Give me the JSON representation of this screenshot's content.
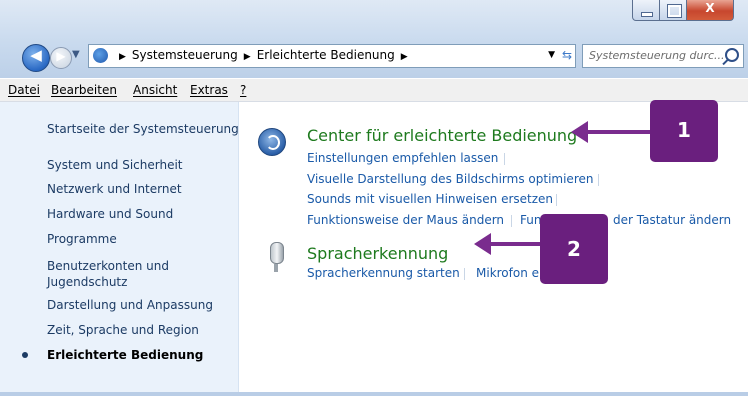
{
  "window": {
    "close_glyph": "X"
  },
  "navigation": {
    "back_glyph": "◀",
    "forward_glyph": "▶"
  },
  "address_bar": {
    "crumbs": [
      "Systemsteuerung",
      "Erleichterte Bedienung"
    ]
  },
  "search": {
    "placeholder": "Systemsteuerung durc..."
  },
  "menu": {
    "items": [
      "Datei",
      "Bearbeiten",
      "Ansicht",
      "Extras",
      "?"
    ]
  },
  "sidebar": {
    "items": [
      "Startseite der Systemsteuerung",
      "System und Sicherheit",
      "Netzwerk und Internet",
      "Hardware und Sound",
      "Programme",
      "Benutzerkonten und",
      "Jugendschutz",
      "Darstellung und Anpassung",
      "Zeit, Sprache und Region",
      "Erleichterte Bedienung"
    ]
  },
  "categories": [
    {
      "title": "Center für erleichterte Bedienung",
      "tasks": [
        "Einstellungen empfehlen lassen",
        "Visuelle Darstellung des Bildschirms optimieren",
        "Sounds mit visuellen Hinweisen ersetzen",
        "Funktionsweise der Maus ändern",
        "Fun",
        "der Tastatur ändern"
      ]
    },
    {
      "title": "Spracherkennung",
      "tasks": [
        "Spracherkennung starten",
        "Mikrofon e"
      ]
    }
  ],
  "callouts": [
    "1",
    "2"
  ],
  "colors": {
    "callout": "#6a1f7e",
    "category_title": "#1e7a1e",
    "task_link": "#1a5aa8",
    "sidebar_link": "#1c3b64"
  }
}
